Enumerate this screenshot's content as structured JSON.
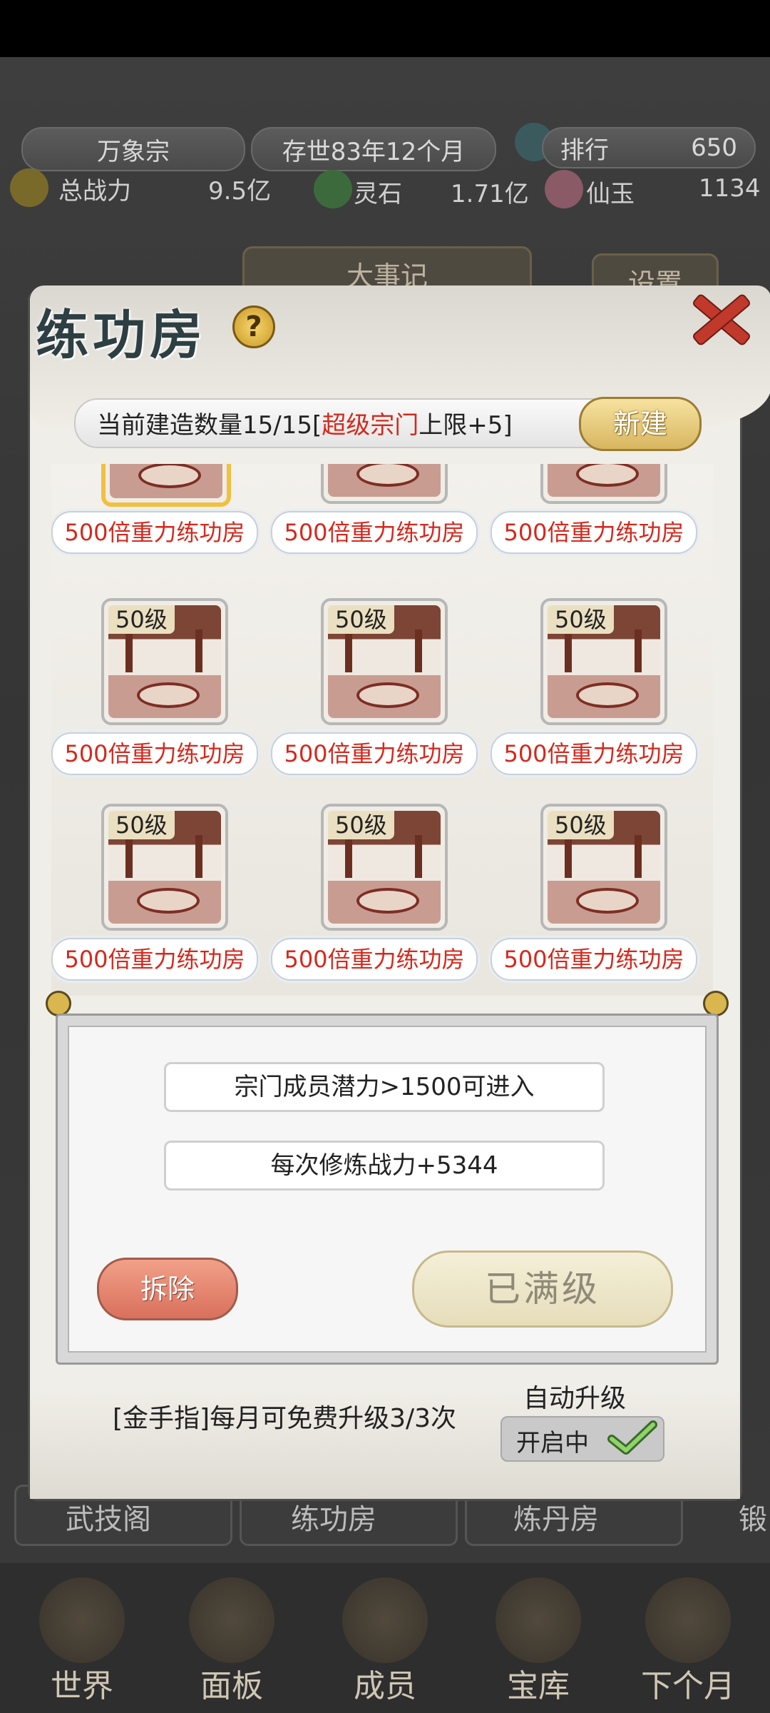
{
  "hud": {
    "sect_name": "万象宗",
    "age": "存世83年12个月",
    "rank_label": "排行",
    "rank_value": "650",
    "power_label": "总战力",
    "power_value": "9.5亿",
    "spirit_stone_label": "灵石",
    "spirit_stone_value": "1.71亿",
    "jade_label": "仙玉",
    "jade_value": "1134"
  },
  "background": {
    "chronicle_tab": "大事记",
    "settings_button": "设置",
    "hall_labels": [
      "武技阁",
      "练功房",
      "炼丹房",
      "锻"
    ]
  },
  "bottom_nav": [
    {
      "label": "世界",
      "icon": "world-icon"
    },
    {
      "label": "面板",
      "icon": "panel-icon"
    },
    {
      "label": "成员",
      "icon": "members-icon"
    },
    {
      "label": "宝库",
      "icon": "treasury-icon"
    },
    {
      "label": "下个月",
      "icon": "next-month-icon"
    }
  ],
  "modal": {
    "title": "练功房",
    "capacity_prefix": "当前建造数量15/15[",
    "capacity_highlight": "超级宗门",
    "capacity_suffix": "上限+5]",
    "new_button": "新建",
    "rooms": [
      {
        "name": "500倍重力练功房",
        "level": "",
        "selected": true
      },
      {
        "name": "500倍重力练功房",
        "level": ""
      },
      {
        "name": "500倍重力练功房",
        "level": ""
      },
      {
        "name": "500倍重力练功房",
        "level": "50级"
      },
      {
        "name": "500倍重力练功房",
        "level": "50级"
      },
      {
        "name": "500倍重力练功房",
        "level": "50级"
      },
      {
        "name": "500倍重力练功房",
        "level": "50级"
      },
      {
        "name": "500倍重力练功房",
        "level": "50级"
      },
      {
        "name": "500倍重力练功房",
        "level": "50级"
      }
    ],
    "requirement": "宗门成员潜力>1500可进入",
    "bonus": "每次修炼战力+5344",
    "demolish_button": "拆除",
    "max_level_button": "已满级",
    "gold_finger": "[金手指]每月可免费升级3/3次",
    "auto_upgrade_label": "自动升级",
    "auto_upgrade_state": "开启中"
  },
  "colors": {
    "highlight_red": "#d12b1f",
    "title_ink": "#2d3f43",
    "gold": "#d8b660"
  }
}
